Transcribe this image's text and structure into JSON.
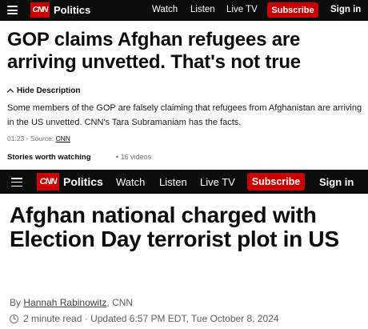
{
  "nav_top": {
    "logo": "CNN",
    "section": "Politics",
    "links": [
      "Watch",
      "Listen",
      "Live TV"
    ],
    "subscribe": "Subscribe",
    "signin": "Sign in"
  },
  "video": {
    "headline": "GOP claims Afghan refugees are arriving unvetted. That's not true",
    "hide_description": "Hide Description",
    "description": "Some members of the GOP are falsely claiming that refugees from Afghanistan are arriving in the US unvetted. CNN's Tara Subramaniam has the facts.",
    "duration": "01:23",
    "source_label": "Source:",
    "source": "CNN",
    "stories_label": "Stories worth watching",
    "video_count": "16 videos"
  },
  "nav_bottom": {
    "logo": "CNN",
    "section": "Politics",
    "links": [
      "Watch",
      "Listen",
      "Live TV"
    ],
    "subscribe": "Subscribe",
    "signin": "Sign in"
  },
  "article": {
    "headline": "Afghan national charged with Election Day terrorist plot in US",
    "by_prefix": "By",
    "author": "Hannah Rabinowitz",
    "outlet": ", CNN",
    "read_time": "2 minute read",
    "updated": "Updated 6:57 PM EDT, Tue October 8, 2024"
  },
  "colors": {
    "brand_red": "#cc0000",
    "nav_bg": "#0c0c0c"
  }
}
